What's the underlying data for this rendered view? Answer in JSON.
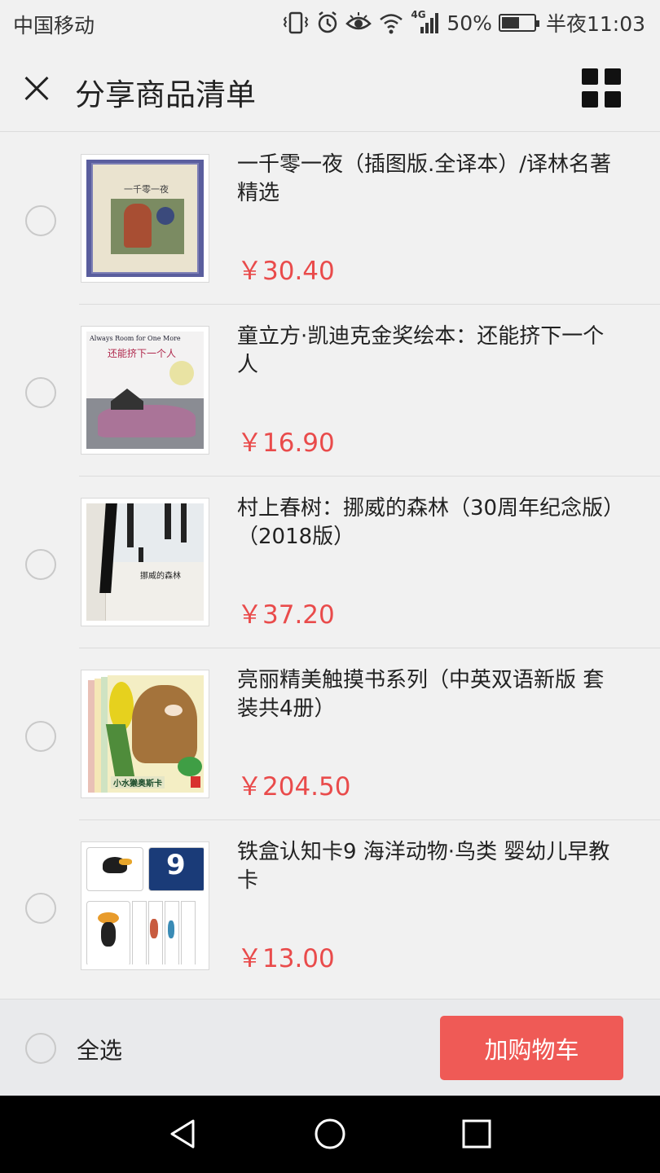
{
  "status_bar": {
    "carrier": "中国移动",
    "network": "4G",
    "battery": "50%",
    "battery_level": 0.5,
    "time": "半夜11:03",
    "icons": [
      "vibrate-icon",
      "alarm-icon",
      "eye-icon",
      "wifi-icon",
      "signal-icon",
      "battery-icon"
    ]
  },
  "header": {
    "title": "分享商品清单",
    "close_icon": "close-icon",
    "grid_icon": "grid-icon"
  },
  "items": [
    {
      "name": "一千零一夜（插图版.全译本）/译林名著精选",
      "price": "￥30.40"
    },
    {
      "name": "童立方·凯迪克金奖绘本：还能挤下一个人",
      "price": "￥16.90"
    },
    {
      "name": "村上春树：挪威的森林（30周年纪念版）（2018版）",
      "price": "￥37.20"
    },
    {
      "name": "亮丽精美触摸书系列（中英双语新版 套装共4册）",
      "price": "￥204.50"
    },
    {
      "name": "铁盒认知卡9 海洋动物·鸟类 婴幼儿早教卡",
      "price": "￥13.00"
    }
  ],
  "covers": {
    "book1": {
      "title": "一千零一夜"
    },
    "book2": {
      "title_en": "Always Room for One More",
      "title_cn": "还能挤下一个人"
    },
    "book3": {
      "title": "挪威的森林"
    },
    "book4": {
      "title": "小水獭奥斯卡"
    },
    "book5": {
      "number": "9"
    }
  },
  "bottom_bar": {
    "select_all": "全选",
    "add_to_cart": "加购物车"
  },
  "colors": {
    "price": "#e94b4b",
    "button": "#ef5a56",
    "background": "#f1f1f1"
  }
}
